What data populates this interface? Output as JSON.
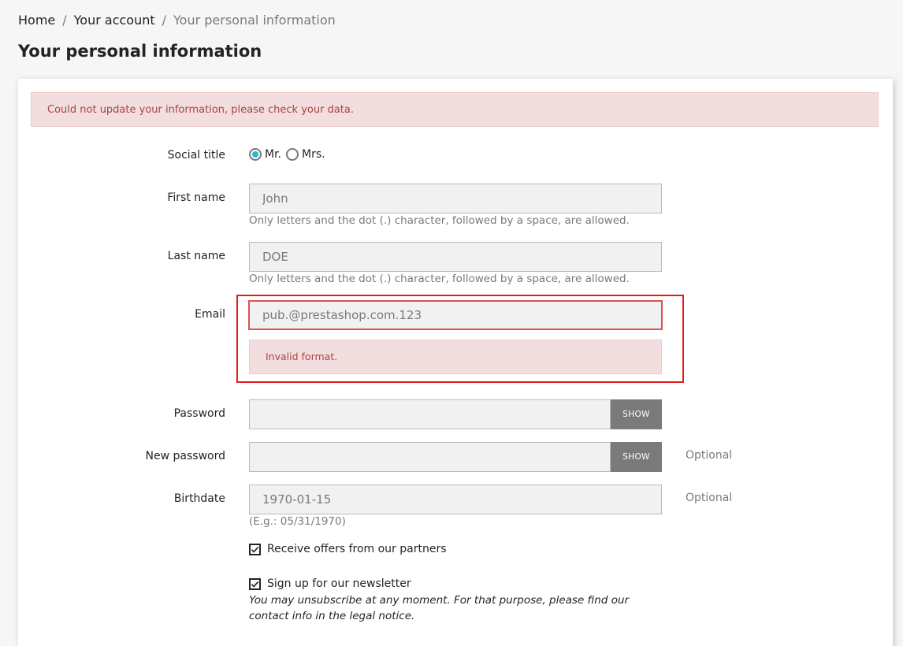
{
  "breadcrumb": {
    "home": "Home",
    "account": "Your account",
    "current": "Your personal information",
    "separator": "/"
  },
  "page": {
    "title": "Your personal information"
  },
  "alert": {
    "message": "Could not update your information, please check your data."
  },
  "form": {
    "social_title": {
      "label": "Social title",
      "options": [
        {
          "label": "Mr.",
          "checked": true
        },
        {
          "label": "Mrs.",
          "checked": false
        }
      ]
    },
    "first_name": {
      "label": "First name",
      "value": "John",
      "help": "Only letters and the dot (.) character, followed by a space, are allowed."
    },
    "last_name": {
      "label": "Last name",
      "value": "DOE",
      "help": "Only letters and the dot (.) character, followed by a space, are allowed."
    },
    "email": {
      "label": "Email",
      "value": "pub.@prestashop.com.123",
      "error": "Invalid format."
    },
    "password": {
      "label": "Password",
      "value": "",
      "show_label": "SHOW"
    },
    "new_password": {
      "label": "New password",
      "value": "",
      "show_label": "SHOW",
      "optional": "Optional"
    },
    "birthdate": {
      "label": "Birthdate",
      "value": "1970-01-15",
      "help": "(E.g.: 05/31/1970)",
      "optional": "Optional"
    },
    "partner_offers": {
      "label": "Receive offers from our partners",
      "checked": true
    },
    "newsletter": {
      "label": "Sign up for our newsletter",
      "checked": true,
      "note": "You may unsubscribe at any moment. For that purpose, please find our contact info in the legal notice."
    }
  },
  "colors": {
    "accent": "#24b9d7",
    "error": "#a94442",
    "error_bg": "#f2dede",
    "highlight": "#e31b1b"
  }
}
